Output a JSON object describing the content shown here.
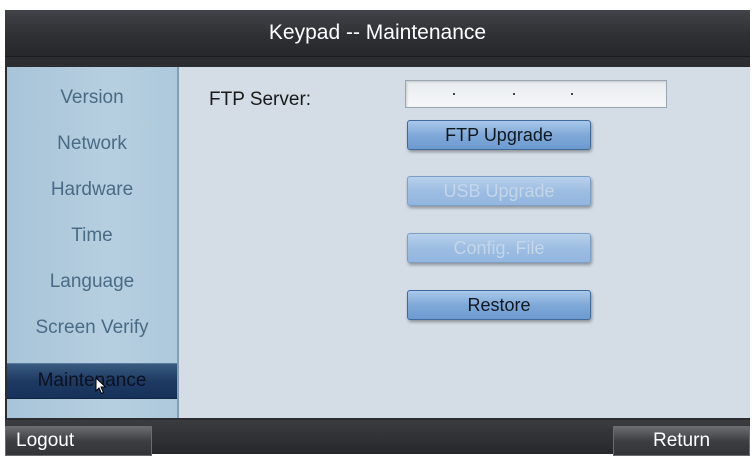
{
  "window": {
    "title": "Keypad -- Maintenance"
  },
  "sidebar": {
    "items": [
      {
        "label": "Version"
      },
      {
        "label": "Network"
      },
      {
        "label": "Hardware"
      },
      {
        "label": "Time"
      },
      {
        "label": "Language"
      },
      {
        "label": "Screen Verify"
      },
      {
        "label": "Maintenance",
        "active": true
      }
    ]
  },
  "main": {
    "ftp_server_label": "FTP Server:",
    "ftp_server_value": "",
    "buttons": {
      "ftp_upgrade": "FTP Upgrade",
      "usb_upgrade": "USB Upgrade",
      "config_file": "Config. File",
      "restore": "Restore"
    }
  },
  "footer": {
    "logout_label": "Logout",
    "return_label": "Return"
  },
  "colors": {
    "title_bg": "#2e3034",
    "sidebar_bg": "#b6cfe0",
    "content_bg": "#d4dde6",
    "active_item_bg": "#1e3a62",
    "button_bg": "#7fa9d8"
  },
  "icons": {
    "cursor": "arrow-cursor-icon"
  }
}
